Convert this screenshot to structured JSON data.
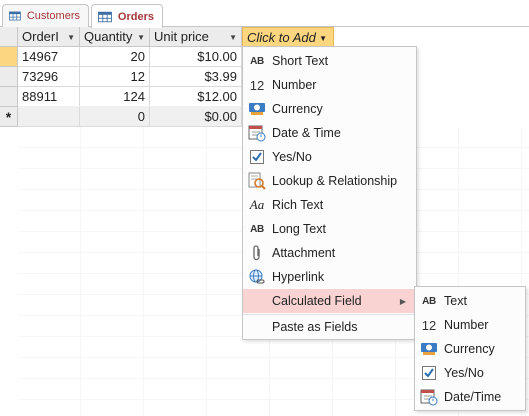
{
  "tabs": [
    {
      "label": "Customers",
      "active": false
    },
    {
      "label": "Orders",
      "active": true
    }
  ],
  "grid": {
    "columns": [
      {
        "label": "OrderI"
      },
      {
        "label": "Quantity"
      },
      {
        "label": "Unit price"
      }
    ],
    "rows": [
      {
        "order_id": "14967",
        "quantity": "20",
        "unit_price": "$10.00"
      },
      {
        "order_id": "73296",
        "quantity": "12",
        "unit_price": "$3.99"
      },
      {
        "order_id": "88911",
        "quantity": "124",
        "unit_price": "$12.00"
      }
    ],
    "new_row": {
      "marker": "*",
      "quantity": "0",
      "unit_price": "$0.00"
    },
    "click_to_add": "Click to Add"
  },
  "field_menu": {
    "items": [
      {
        "label": "Short Text",
        "icon": "ab-text-icon",
        "icon_text": "AB"
      },
      {
        "label": "Number",
        "icon": "number-icon",
        "icon_text": "12"
      },
      {
        "label": "Currency",
        "icon": "currency-icon"
      },
      {
        "label": "Date & Time",
        "icon": "calendar-icon"
      },
      {
        "label": "Yes/No",
        "icon": "checkbox-icon"
      },
      {
        "label": "Lookup & Relationship",
        "icon": "lookup-icon"
      },
      {
        "label": "Rich Text",
        "icon": "rich-text-icon",
        "icon_text": "Aa"
      },
      {
        "label": "Long Text",
        "icon": "long-text-icon",
        "icon_text": "AB"
      },
      {
        "label": "Attachment",
        "icon": "paperclip-icon"
      },
      {
        "label": "Hyperlink",
        "icon": "globe-link-icon"
      },
      {
        "label": "Calculated Field",
        "icon": "",
        "highlighted": true,
        "has_submenu": true
      },
      {
        "label": "Paste as Fields",
        "icon": ""
      }
    ]
  },
  "calculated_submenu": {
    "items": [
      {
        "label": "Text",
        "icon": "ab-text-icon",
        "icon_text": "AB"
      },
      {
        "label": "Number",
        "icon": "number-icon",
        "icon_text": "12"
      },
      {
        "label": "Currency",
        "icon": "currency-icon"
      },
      {
        "label": "Yes/No",
        "icon": "checkbox-icon"
      },
      {
        "label": "Date/Time",
        "icon": "calendar-icon"
      }
    ]
  },
  "colors": {
    "accent_tab_text": "#a4373a",
    "click_to_add_bg": "#fcd77f",
    "menu_highlight": "#f8d3d1",
    "checkbox_blue": "#2b6cb0"
  }
}
